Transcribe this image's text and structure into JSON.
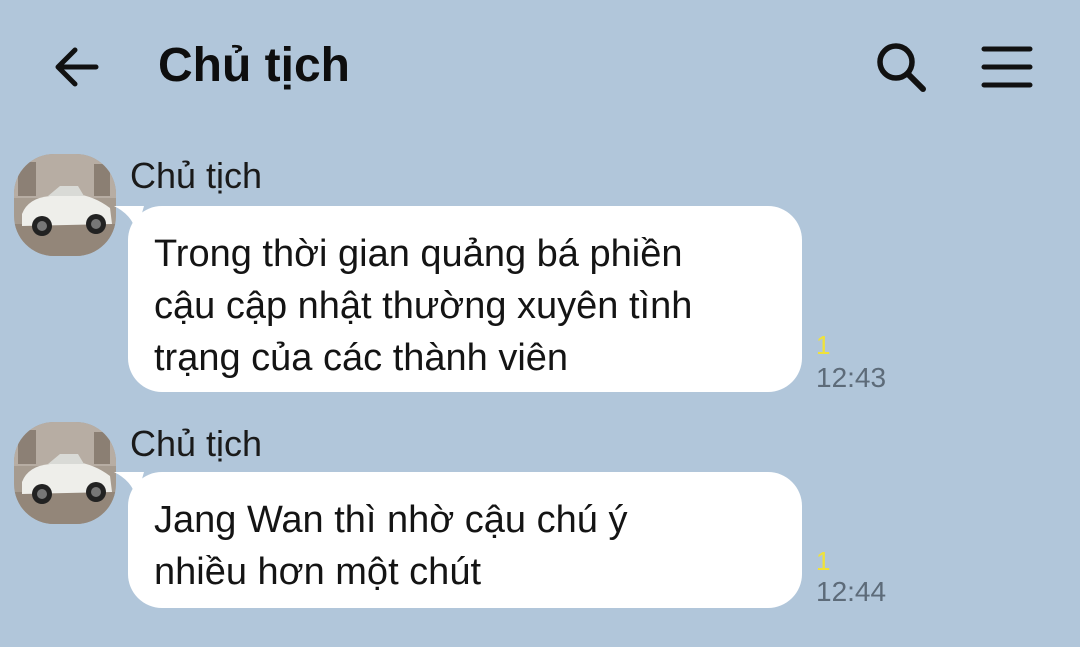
{
  "header": {
    "back_icon": "arrow-left-icon",
    "title": "Chủ tịch",
    "search_icon": "search-icon",
    "menu_icon": "hamburger-menu-icon"
  },
  "messages": [
    {
      "sender": "Chủ tịch",
      "avatar": "avatar-vintage-car",
      "lines": [
        "Trong thời gian quảng bá phiền",
        "cậu cập nhật thường xuyên tình",
        "trạng của các thành viên"
      ],
      "unread": "1",
      "time": "12:43"
    },
    {
      "sender": "Chủ tịch",
      "avatar": "avatar-vintage-car",
      "lines": [
        "Jang Wan thì nhờ cậu chú ý",
        "nhiều hơn một chút"
      ],
      "unread": "1",
      "time": "12:44"
    }
  ],
  "colors": {
    "background": "#b1c6da",
    "bubble": "#ffffff",
    "unread": "#f0e23a",
    "time": "#5d6b79"
  }
}
